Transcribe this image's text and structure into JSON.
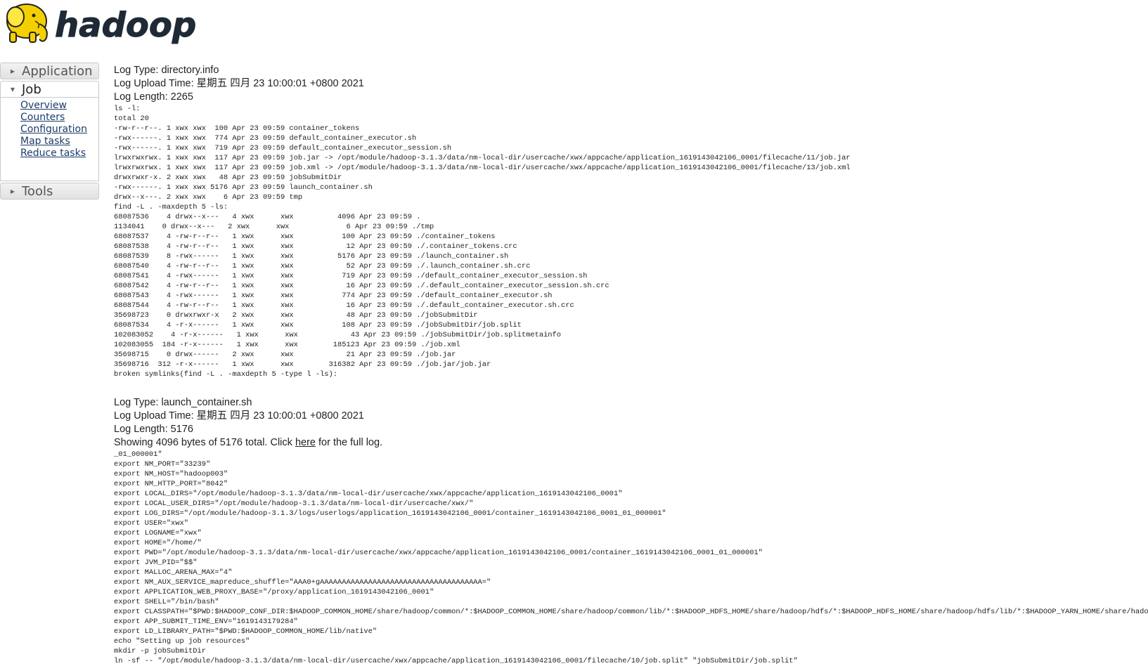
{
  "logo": {
    "text": "hadoop",
    "icon": "elephant-icon"
  },
  "sidebar": {
    "sections": [
      {
        "title": "Application",
        "expanded": false
      },
      {
        "title": "Job",
        "expanded": true,
        "links": [
          "Overview",
          "Counters",
          "Configuration",
          "Map tasks",
          "Reduce tasks"
        ]
      },
      {
        "title": "Tools",
        "expanded": false
      }
    ]
  },
  "logs": [
    {
      "type": "Log Type: directory.info",
      "upload_time": "Log Upload Time: 星期五 四月 23 10:00:01 +0800 2021",
      "length": "Log Length: 2265",
      "content": "ls -l:\ntotal 20\n-rw-r--r--. 1 xwx xwx  100 Apr 23 09:59 container_tokens\n-rwx------. 1 xwx xwx  774 Apr 23 09:59 default_container_executor.sh\n-rwx------. 1 xwx xwx  719 Apr 23 09:59 default_container_executor_session.sh\nlrwxrwxrwx. 1 xwx xwx  117 Apr 23 09:59 job.jar -> /opt/module/hadoop-3.1.3/data/nm-local-dir/usercache/xwx/appcache/application_1619143042106_0001/filecache/11/job.jar\nlrwxrwxrwx. 1 xwx xwx  117 Apr 23 09:59 job.xml -> /opt/module/hadoop-3.1.3/data/nm-local-dir/usercache/xwx/appcache/application_1619143042106_0001/filecache/13/job.xml\ndrwxrwxr-x. 2 xwx xwx   48 Apr 23 09:59 jobSubmitDir\n-rwx------. 1 xwx xwx 5176 Apr 23 09:59 launch_container.sh\ndrwx--x---. 2 xwx xwx    6 Apr 23 09:59 tmp\nfind -L . -maxdepth 5 -ls:\n68087536    4 drwx--x---   4 xwx      xwx          4096 Apr 23 09:59 .\n1134041    0 drwx--x---   2 xwx      xwx             6 Apr 23 09:59 ./tmp\n68087537    4 -rw-r--r--   1 xwx      xwx           100 Apr 23 09:59 ./container_tokens\n68087538    4 -rw-r--r--   1 xwx      xwx            12 Apr 23 09:59 ./.container_tokens.crc\n68087539    8 -rwx------   1 xwx      xwx          5176 Apr 23 09:59 ./launch_container.sh\n68087540    4 -rw-r--r--   1 xwx      xwx            52 Apr 23 09:59 ./.launch_container.sh.crc\n68087541    4 -rwx------   1 xwx      xwx           719 Apr 23 09:59 ./default_container_executor_session.sh\n68087542    4 -rw-r--r--   1 xwx      xwx            16 Apr 23 09:59 ./.default_container_executor_session.sh.crc\n68087543    4 -rwx------   1 xwx      xwx           774 Apr 23 09:59 ./default_container_executor.sh\n68087544    4 -rw-r--r--   1 xwx      xwx            16 Apr 23 09:59 ./.default_container_executor.sh.crc\n35698723    0 drwxrwxr-x   2 xwx      xwx            48 Apr 23 09:59 ./jobSubmitDir\n68087534    4 -r-x------   1 xwx      xwx           108 Apr 23 09:59 ./jobSubmitDir/job.split\n102083052    4 -r-x------   1 xwx      xwx            43 Apr 23 09:59 ./jobSubmitDir/job.splitmetainfo\n102083055  184 -r-x------   1 xwx      xwx        185123 Apr 23 09:59 ./job.xml\n35698715    0 drwx------   2 xwx      xwx            21 Apr 23 09:59 ./job.jar\n35698716  312 -r-x------   1 xwx      xwx        316382 Apr 23 09:59 ./job.jar/job.jar\nbroken symlinks(find -L . -maxdepth 5 -type l -ls):"
    },
    {
      "type": "Log Type: launch_container.sh",
      "upload_time": "Log Upload Time: 星期五 四月 23 10:00:01 +0800 2021",
      "length": "Log Length: 5176",
      "showing_prefix": "Showing 4096 bytes of 5176 total. Click ",
      "showing_link": "here",
      "showing_suffix": " for the full log.",
      "content": "_01_000001\"\nexport NM_PORT=\"33239\"\nexport NM_HOST=\"hadoop003\"\nexport NM_HTTP_PORT=\"8042\"\nexport LOCAL_DIRS=\"/opt/module/hadoop-3.1.3/data/nm-local-dir/usercache/xwx/appcache/application_1619143042106_0001\"\nexport LOCAL_USER_DIRS=\"/opt/module/hadoop-3.1.3/data/nm-local-dir/usercache/xwx/\"\nexport LOG_DIRS=\"/opt/module/hadoop-3.1.3/logs/userlogs/application_1619143042106_0001/container_1619143042106_0001_01_000001\"\nexport USER=\"xwx\"\nexport LOGNAME=\"xwx\"\nexport HOME=\"/home/\"\nexport PWD=\"/opt/module/hadoop-3.1.3/data/nm-local-dir/usercache/xwx/appcache/application_1619143042106_0001/container_1619143042106_0001_01_000001\"\nexport JVM_PID=\"$$\"\nexport MALLOC_ARENA_MAX=\"4\"\nexport NM_AUX_SERVICE_mapreduce_shuffle=\"AAA0+gAAAAAAAAAAAAAAAAAAAAAAAAAAAAAAAAAAAAA=\"\nexport APPLICATION_WEB_PROXY_BASE=\"/proxy/application_1619143042106_0001\"\nexport SHELL=\"/bin/bash\"\nexport CLASSPATH=\"$PWD:$HADOOP_CONF_DIR:$HADOOP_COMMON_HOME/share/hadoop/common/*:$HADOOP_COMMON_HOME/share/hadoop/common/lib/*:$HADOOP_HDFS_HOME/share/hadoop/hdfs/*:$HADOOP_HDFS_HOME/share/hadoop/hdfs/lib/*:$HADOOP_YARN_HOME/share/hadoop/yarn/*\nexport APP_SUBMIT_TIME_ENV=\"1619143179284\"\nexport LD_LIBRARY_PATH=\"$PWD:$HADOOP_COMMON_HOME/lib/native\"\necho \"Setting up job resources\"\nmkdir -p jobSubmitDir\nln -sf -- \"/opt/module/hadoop-3.1.3/data/nm-local-dir/usercache/xwx/appcache/application_1619143042106_0001/filecache/10/job.split\" \"jobSubmitDir/job.split\""
    }
  ]
}
